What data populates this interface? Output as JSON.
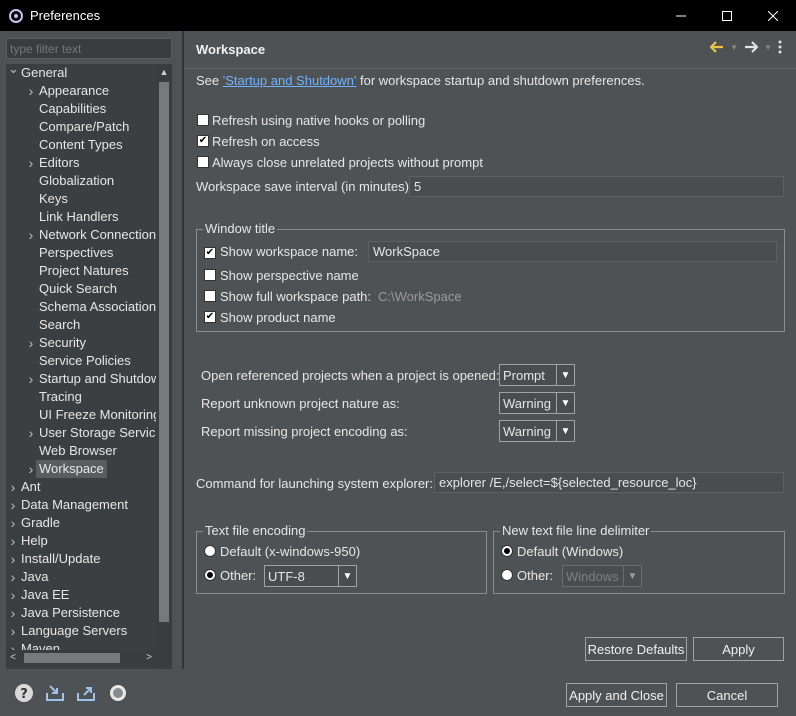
{
  "window": {
    "title": "Preferences"
  },
  "filter": {
    "placeholder": "type filter text"
  },
  "tree": [
    {
      "label": "General",
      "level": 0,
      "expanded": true,
      "arrow": true
    },
    {
      "label": "Appearance",
      "level": 1,
      "arrow": true
    },
    {
      "label": "Capabilities",
      "level": 1,
      "arrow": false
    },
    {
      "label": "Compare/Patch",
      "level": 1,
      "arrow": false
    },
    {
      "label": "Content Types",
      "level": 1,
      "arrow": false
    },
    {
      "label": "Editors",
      "level": 1,
      "arrow": true
    },
    {
      "label": "Globalization",
      "level": 1,
      "arrow": false
    },
    {
      "label": "Keys",
      "level": 1,
      "arrow": false
    },
    {
      "label": "Link Handlers",
      "level": 1,
      "arrow": false
    },
    {
      "label": "Network Connection",
      "level": 1,
      "arrow": true
    },
    {
      "label": "Perspectives",
      "level": 1,
      "arrow": false
    },
    {
      "label": "Project Natures",
      "level": 1,
      "arrow": false
    },
    {
      "label": "Quick Search",
      "level": 1,
      "arrow": false
    },
    {
      "label": "Schema Association",
      "level": 1,
      "arrow": false
    },
    {
      "label": "Search",
      "level": 1,
      "arrow": false
    },
    {
      "label": "Security",
      "level": 1,
      "arrow": true
    },
    {
      "label": "Service Policies",
      "level": 1,
      "arrow": false
    },
    {
      "label": "Startup and Shutdown",
      "level": 1,
      "arrow": true
    },
    {
      "label": "Tracing",
      "level": 1,
      "arrow": false
    },
    {
      "label": "UI Freeze Monitoring",
      "level": 1,
      "arrow": false
    },
    {
      "label": "User Storage Service",
      "level": 1,
      "arrow": true
    },
    {
      "label": "Web Browser",
      "level": 1,
      "arrow": false
    },
    {
      "label": "Workspace",
      "level": 1,
      "arrow": true,
      "selected": true
    },
    {
      "label": "Ant",
      "level": 0,
      "arrow": true
    },
    {
      "label": "Data Management",
      "level": 0,
      "arrow": true
    },
    {
      "label": "Gradle",
      "level": 0,
      "arrow": true
    },
    {
      "label": "Help",
      "level": 0,
      "arrow": true
    },
    {
      "label": "Install/Update",
      "level": 0,
      "arrow": true
    },
    {
      "label": "Java",
      "level": 0,
      "arrow": true
    },
    {
      "label": "Java EE",
      "level": 0,
      "arrow": true
    },
    {
      "label": "Java Persistence",
      "level": 0,
      "arrow": true
    },
    {
      "label": "Language Servers",
      "level": 0,
      "arrow": true
    },
    {
      "label": "Maven",
      "level": 0,
      "arrow": true
    }
  ],
  "page": {
    "title": "Workspace",
    "intro_prefix": "See ",
    "intro_link": "'Startup and Shutdown'",
    "intro_suffix": " for workspace startup and shutdown preferences.",
    "refresh_native": {
      "label": "Refresh using native hooks or polling",
      "checked": false
    },
    "refresh_access": {
      "label": "Refresh on access",
      "checked": true
    },
    "always_close": {
      "label": "Always close unrelated projects without prompt",
      "checked": false
    },
    "save_interval_label": "Workspace save interval (in minutes):",
    "save_interval_value": "5",
    "window_title_group": "Window title",
    "show_ws_name": {
      "label": "Show workspace name:",
      "checked": true,
      "value": "WorkSpace"
    },
    "show_perspective": {
      "label": "Show perspective name",
      "checked": false
    },
    "show_full_path": {
      "label": "Show full workspace path:",
      "checked": false,
      "value": "C:\\WorkSpace"
    },
    "show_product": {
      "label": "Show product name",
      "checked": true
    },
    "open_ref_label": "Open referenced projects when a project is opened:",
    "open_ref_value": "Prompt",
    "unknown_nature_label": "Report unknown project nature as:",
    "unknown_nature_value": "Warning",
    "missing_enc_label": "Report missing project encoding as:",
    "missing_enc_value": "Warning",
    "explorer_label": "Command for launching system explorer:",
    "explorer_value": "explorer /E,/select=${selected_resource_loc}",
    "text_enc_group": "Text file encoding",
    "enc_default": {
      "label": "Default (x-windows-950)",
      "selected": false
    },
    "enc_other": {
      "label": "Other:",
      "selected": true,
      "value": "UTF-8"
    },
    "line_delim_group": "New text file line delimiter",
    "delim_default": {
      "label": "Default (Windows)",
      "selected": true
    },
    "delim_other": {
      "label": "Other:",
      "selected": false,
      "value": "Windows"
    },
    "restore_defaults": "Restore Defaults",
    "apply": "Apply"
  },
  "footer": {
    "apply_close": "Apply and Close",
    "cancel": "Cancel"
  },
  "colors": {
    "background": "#4f5254",
    "tree_background": "#3c3f41",
    "titlebar": "#000000",
    "link": "#6fb3ff",
    "accent_arrow": "#e8c24a"
  }
}
